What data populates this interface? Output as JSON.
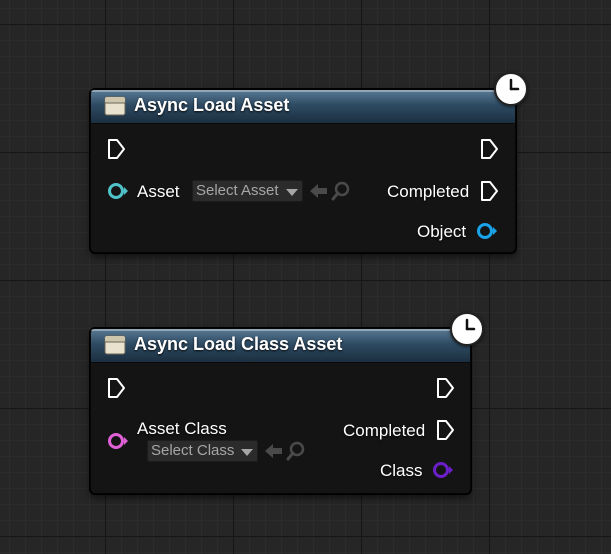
{
  "nodes": [
    {
      "title": "Async Load Asset",
      "header_color": "#2e4b63",
      "icon": "function-node-icon",
      "latent_icon": "clock-icon",
      "input_param": {
        "label": "Asset",
        "pin_color": "#4fc3c9",
        "dropdown": "Select Asset"
      },
      "outputs": [
        {
          "label": "Completed",
          "type": "exec"
        },
        {
          "label": "Object",
          "pin_color": "#1aa3e8"
        }
      ]
    },
    {
      "title": "Async Load Class Asset",
      "header_color": "#2e4b63",
      "icon": "function-node-icon",
      "latent_icon": "clock-icon",
      "input_param": {
        "label": "Asset Class",
        "pin_color": "#e060d6",
        "dropdown": "Select Class"
      },
      "outputs": [
        {
          "label": "Completed",
          "type": "exec"
        },
        {
          "label": "Class",
          "pin_color": "#6a1fc8"
        }
      ]
    }
  ],
  "grid_background": "#262626"
}
